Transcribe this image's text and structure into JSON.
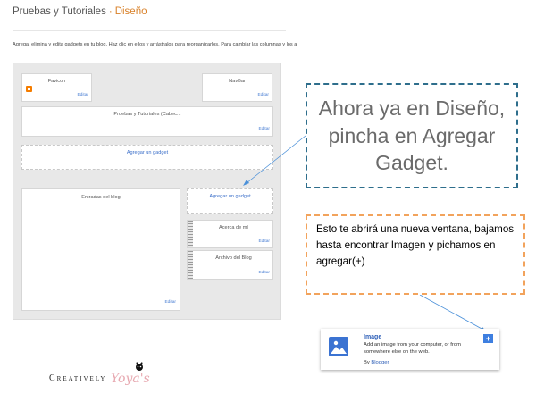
{
  "header": {
    "title": "Pruebas y Tutoriales",
    "separator": "·",
    "crumb": "Diseño"
  },
  "description": "Agrega, elimina y edita gadgets en tu blog. Haz clic en ellos y arrástralos para reorganizarlos. Para cambiar las columnas y los anchos, usa",
  "layout": {
    "favicon": {
      "title": "Favicon",
      "edit": "Editar"
    },
    "navbar": {
      "title": "NavBar",
      "edit": "Editar"
    },
    "header_gadget": {
      "title": "Pruebas y Tutoriales (Cabec...",
      "edit": "Editar"
    },
    "add_gadget_top": "Agregar un gadget",
    "add_gadget_side": "Agregar un gadget",
    "blog_posts": {
      "title": "Entradas del blog",
      "edit": "Editar"
    },
    "about": {
      "title": "Acerca de mí",
      "edit": "Editar"
    },
    "archive": {
      "title": "Archivo del Blog",
      "edit": "Editar"
    }
  },
  "callout1": {
    "text": "Ahora ya en Diseño, pincha en Agregar Gadget."
  },
  "callout2": {
    "text": "Esto te abrirá una nueva ventana, bajamos hasta encontrar Imagen y pichamos en agregar(+)"
  },
  "image_gadget": {
    "title": "Image",
    "description": "Add an image from your computer, or from somewhere else on the web.",
    "by_label": "By",
    "by_link": "Blogger",
    "add_label": "+"
  },
  "logo": {
    "text": "Creatively",
    "script": "Yoya's"
  },
  "colors": {
    "accent_orange": "#d9822b",
    "link_blue": "#3b6fc9",
    "callout_blue": "#2e6e8c",
    "callout_orange": "#f2a35c"
  }
}
